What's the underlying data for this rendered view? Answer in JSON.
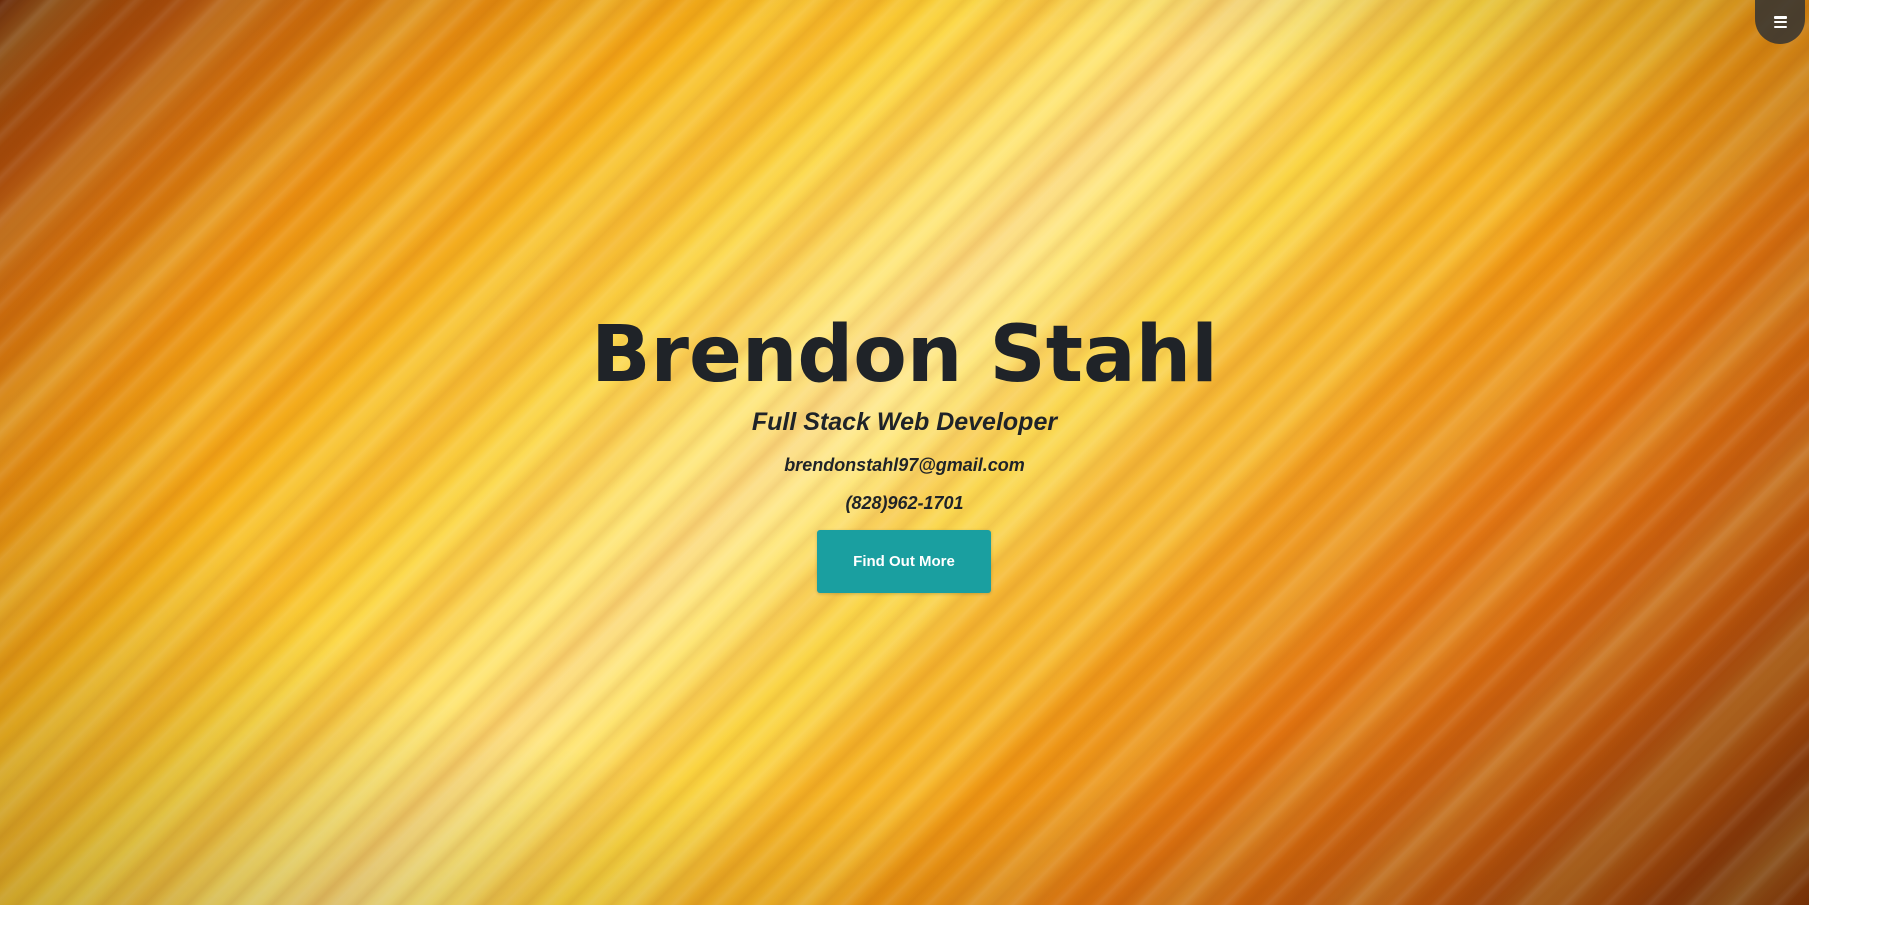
{
  "menu": {
    "icon": "hamburger-menu-icon"
  },
  "hero": {
    "name": "Brendon Stahl",
    "title": "Full Stack Web Developer",
    "email": "brendonstahl97@gmail.com",
    "phone": "(828)962-1701",
    "cta_label": "Find Out More"
  },
  "colors": {
    "accent": "#1a9fa0",
    "text": "#1f2328",
    "menu_bg": "#333333",
    "hero_gradient": [
      "#7a2f08",
      "#e88c10",
      "#fbd23a",
      "#ffe98a",
      "#e07410",
      "#7d3008"
    ]
  }
}
